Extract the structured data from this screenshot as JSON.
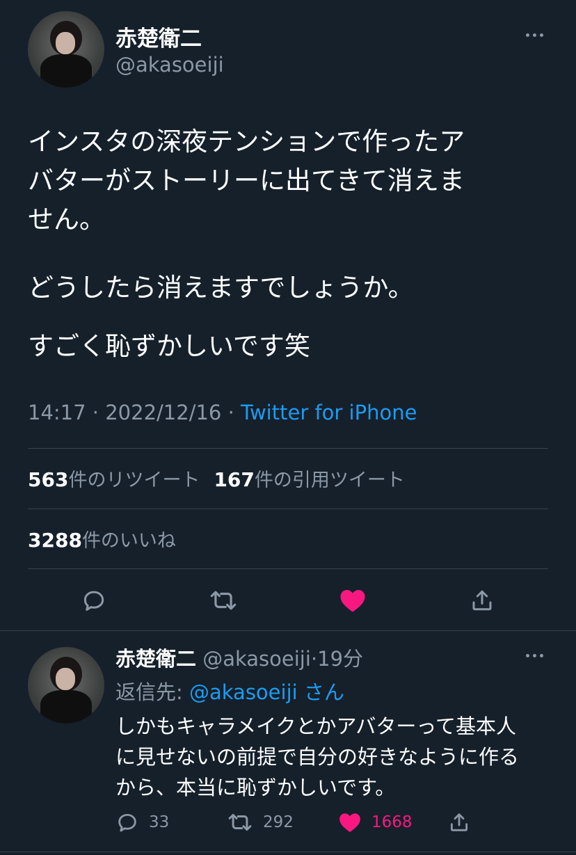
{
  "colors": {
    "background": "#15202b",
    "divider": "#38444d",
    "secondary_text": "#8b98a5",
    "link": "#1d9bf0",
    "like_active": "#f91880"
  },
  "tweet": {
    "author_name": "赤楚衛二",
    "author_handle": "@akasoeiji",
    "body_lines": [
      "インスタの深夜テンションで作ったア",
      "バターがストーリーに出てきて消えま",
      "せん。"
    ],
    "body_para2": "どうしたら消えますでしょうか。",
    "body_para3": "すごく恥ずかしいです笑",
    "time": "14:17",
    "date": "2022/12/16",
    "separator": "·",
    "source": "Twitter for iPhone",
    "stats": {
      "retweets_count": "563",
      "retweets_label": "件のリツイート",
      "quotes_count": "167",
      "quotes_label": "件の引用ツイート",
      "likes_count": "3288",
      "likes_label": "件のいいね"
    },
    "actions": [
      {
        "icon": "reply-icon"
      },
      {
        "icon": "retweet-icon"
      },
      {
        "icon": "heart-filled-icon",
        "active": true
      },
      {
        "icon": "share-icon"
      }
    ]
  },
  "reply": {
    "author_name": "赤楚衛二",
    "author_handle": "@akasoeiji",
    "time_ago": "19分",
    "separator": "·",
    "reply_to_label": "返信先:",
    "reply_to_mention": "@akasoeiji",
    "reply_to_suffix": "さん",
    "body_lines": [
      "しかもキャラメイクとかアバターって基本人",
      "に見せないの前提で自分の好きなように作る",
      "から、本当に恥ずかしいです。"
    ],
    "reply_count": "33",
    "retweet_count": "292",
    "like_count": "1668"
  }
}
